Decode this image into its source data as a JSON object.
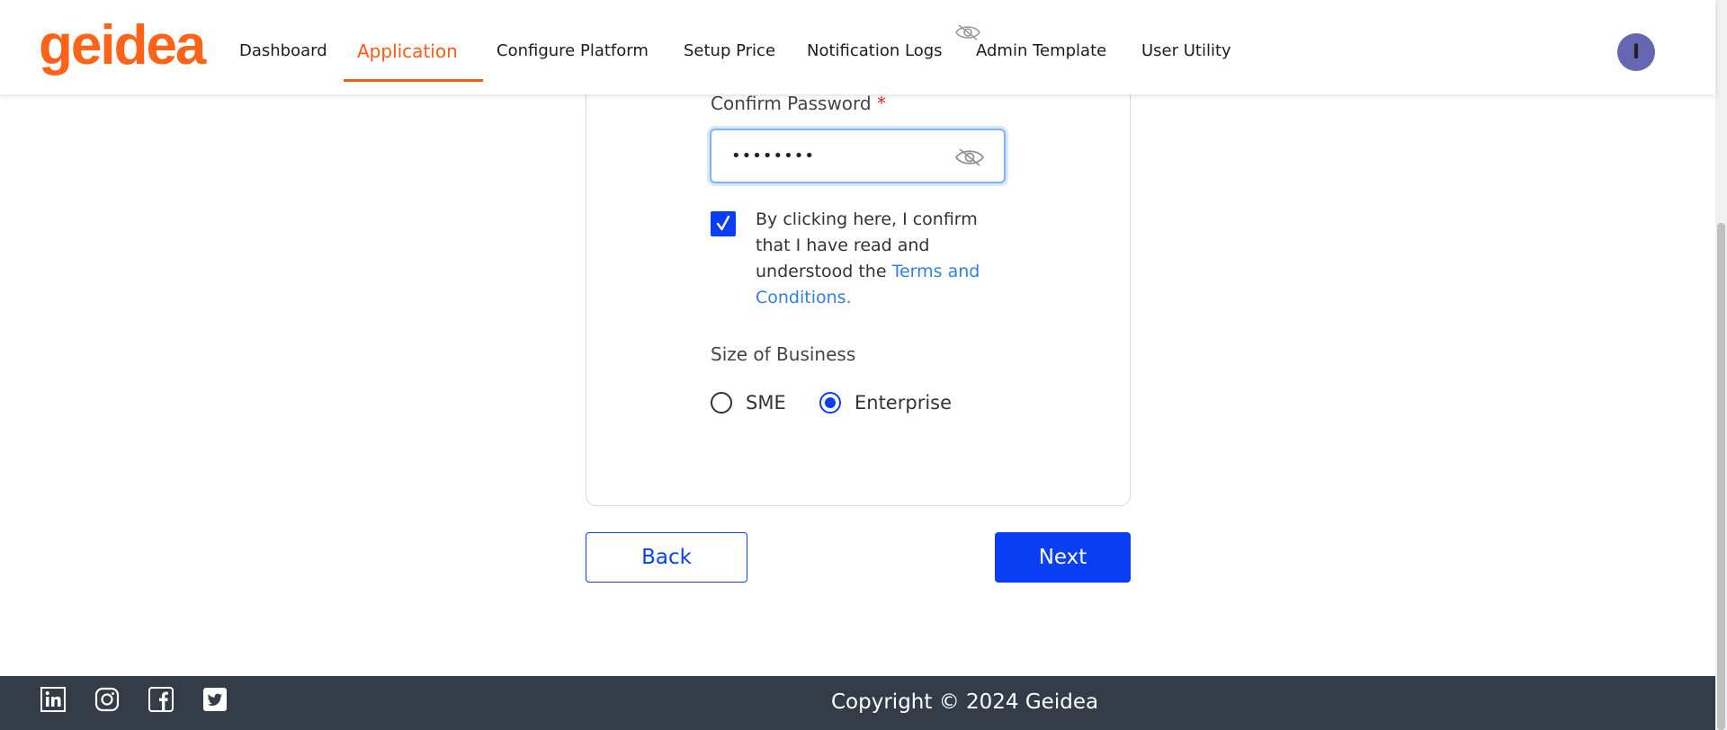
{
  "header": {
    "logo_text": "geidea",
    "nav": [
      {
        "label": "Dashboard",
        "active": false
      },
      {
        "label": "Application",
        "active": true
      },
      {
        "label": "Configure Platform",
        "active": false
      },
      {
        "label": "Setup Price",
        "active": false
      },
      {
        "label": "Notification Logs",
        "active": false
      },
      {
        "label": "Admin Template",
        "active": false
      },
      {
        "label": "User Utility",
        "active": false
      }
    ],
    "avatar_initial": "I"
  },
  "form": {
    "confirm_password_label": "Confirm Password",
    "required_marker": "*",
    "confirm_password_value": "••••••••",
    "visibility_icon": "eye-slash-icon",
    "consent_checked": true,
    "consent_text": "By clicking here, I confirm that I have read and understood the ",
    "consent_link": "Terms and Conditions.",
    "size_label": "Size of Business",
    "size_options": [
      {
        "label": "SME",
        "selected": false
      },
      {
        "label": "Enterprise",
        "selected": true
      }
    ]
  },
  "actions": {
    "back_label": "Back",
    "next_label": "Next"
  },
  "footer": {
    "social_icons": [
      "linkedin-icon",
      "instagram-icon",
      "facebook-icon",
      "twitter-icon"
    ],
    "copyright": "Copyright © 2024 Geidea"
  },
  "colors": {
    "brand_orange": "#ff6319",
    "primary_blue": "#0a3ef5",
    "link_blue": "#2f7fe6",
    "footer_bg": "#333c47",
    "avatar_bg": "#6666b3"
  }
}
